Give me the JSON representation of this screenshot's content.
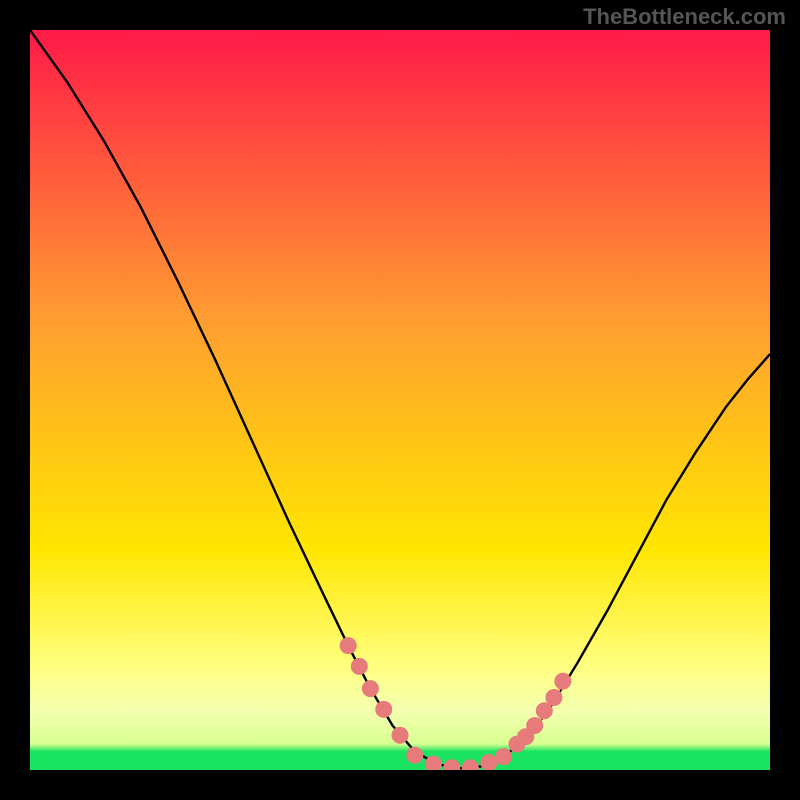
{
  "watermark": "TheBottleneck.com",
  "chart_data": {
    "type": "line",
    "title": "",
    "xlabel": "",
    "ylabel": "",
    "xlim": [
      0,
      1
    ],
    "ylim": [
      0,
      1
    ],
    "background_gradient": {
      "top": "#ff1a48",
      "mid1": "#ffa030",
      "mid2": "#ffe600",
      "low": "#ffff80",
      "bottom": "#19e360"
    },
    "curve": {
      "description": "V-shaped bottleneck curve with minimum near x≈0.58",
      "points": [
        {
          "x": 0.0,
          "y": 1.0
        },
        {
          "x": 0.05,
          "y": 0.93
        },
        {
          "x": 0.1,
          "y": 0.85
        },
        {
          "x": 0.15,
          "y": 0.76
        },
        {
          "x": 0.2,
          "y": 0.66
        },
        {
          "x": 0.25,
          "y": 0.555
        },
        {
          "x": 0.3,
          "y": 0.445
        },
        {
          "x": 0.35,
          "y": 0.335
        },
        {
          "x": 0.4,
          "y": 0.23
        },
        {
          "x": 0.43,
          "y": 0.168
        },
        {
          "x": 0.46,
          "y": 0.11
        },
        {
          "x": 0.49,
          "y": 0.06
        },
        {
          "x": 0.52,
          "y": 0.025
        },
        {
          "x": 0.55,
          "y": 0.008
        },
        {
          "x": 0.58,
          "y": 0.002
        },
        {
          "x": 0.61,
          "y": 0.005
        },
        {
          "x": 0.64,
          "y": 0.018
        },
        {
          "x": 0.67,
          "y": 0.042
        },
        {
          "x": 0.7,
          "y": 0.08
        },
        {
          "x": 0.74,
          "y": 0.145
        },
        {
          "x": 0.78,
          "y": 0.215
        },
        {
          "x": 0.82,
          "y": 0.29
        },
        {
          "x": 0.86,
          "y": 0.365
        },
        {
          "x": 0.9,
          "y": 0.43
        },
        {
          "x": 0.94,
          "y": 0.49
        },
        {
          "x": 0.97,
          "y": 0.528
        },
        {
          "x": 1.0,
          "y": 0.562
        }
      ]
    },
    "markers_left": [
      {
        "x": 0.43,
        "y": 0.168
      },
      {
        "x": 0.445,
        "y": 0.14
      },
      {
        "x": 0.46,
        "y": 0.11
      },
      {
        "x": 0.478,
        "y": 0.082
      },
      {
        "x": 0.5,
        "y": 0.047
      }
    ],
    "markers_bottom": [
      {
        "x": 0.52,
        "y": 0.02
      },
      {
        "x": 0.545,
        "y": 0.008
      },
      {
        "x": 0.57,
        "y": 0.003
      },
      {
        "x": 0.595,
        "y": 0.003
      },
      {
        "x": 0.62,
        "y": 0.01
      },
      {
        "x": 0.64,
        "y": 0.018
      }
    ],
    "markers_right": [
      {
        "x": 0.658,
        "y": 0.035
      },
      {
        "x": 0.67,
        "y": 0.045
      },
      {
        "x": 0.682,
        "y": 0.06
      },
      {
        "x": 0.695,
        "y": 0.08
      },
      {
        "x": 0.708,
        "y": 0.098
      },
      {
        "x": 0.72,
        "y": 0.12
      }
    ],
    "ticks_small": [
      {
        "x": 0.66,
        "y": 0.038
      },
      {
        "x": 0.675,
        "y": 0.052
      },
      {
        "x": 0.69,
        "y": 0.072
      },
      {
        "x": 0.702,
        "y": 0.09
      },
      {
        "x": 0.715,
        "y": 0.112
      }
    ]
  }
}
